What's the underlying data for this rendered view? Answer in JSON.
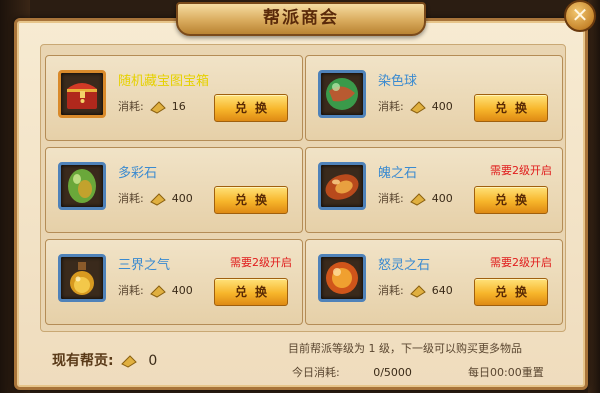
{
  "window": {
    "title": "帮派商会",
    "close_icon": "close-icon",
    "close_label": "✕"
  },
  "items": [
    {
      "name": "随机藏宝图宝箱",
      "cost_label": "消耗:",
      "cost": "16",
      "requirement": "",
      "button": "兑换",
      "icon": "treasure-chest-icon",
      "name_color": "#e6d100"
    },
    {
      "name": "染色球",
      "cost_label": "消耗:",
      "cost": "400",
      "requirement": "",
      "button": "兑换",
      "icon": "dye-orb-icon",
      "name_color": "#3a8ad0"
    },
    {
      "name": "多彩石",
      "cost_label": "消耗:",
      "cost": "400",
      "requirement": "",
      "button": "兑换",
      "icon": "colorful-stone-icon",
      "name_color": "#3a8ad0"
    },
    {
      "name": "魄之石",
      "cost_label": "消耗:",
      "cost": "400",
      "requirement": "需要2级开启",
      "button": "兑换",
      "icon": "soul-stone-icon",
      "name_color": "#3a8ad0"
    },
    {
      "name": "三界之气",
      "cost_label": "消耗:",
      "cost": "400",
      "requirement": "需要2级开启",
      "button": "兑换",
      "icon": "potion-bottle-icon",
      "name_color": "#3a8ad0"
    },
    {
      "name": "怒灵之石",
      "cost_label": "消耗:",
      "cost": "640",
      "requirement": "需要2级开启",
      "button": "兑换",
      "icon": "rage-stone-icon",
      "name_color": "#3a8ad0"
    }
  ],
  "footer": {
    "contribution_label": "现有帮贡:",
    "contribution_value": "0",
    "info": "目前帮派等级为 1 级，下一级可以购买更多物品",
    "today_label": "今日消耗:",
    "today_value": "0/5000",
    "reset": "每日00:00重置"
  },
  "colors": {
    "requirement": "#e01b1b",
    "button": "#f7b52a",
    "frame_blue": "#4f82b9",
    "frame_orange": "#d98a2b"
  }
}
